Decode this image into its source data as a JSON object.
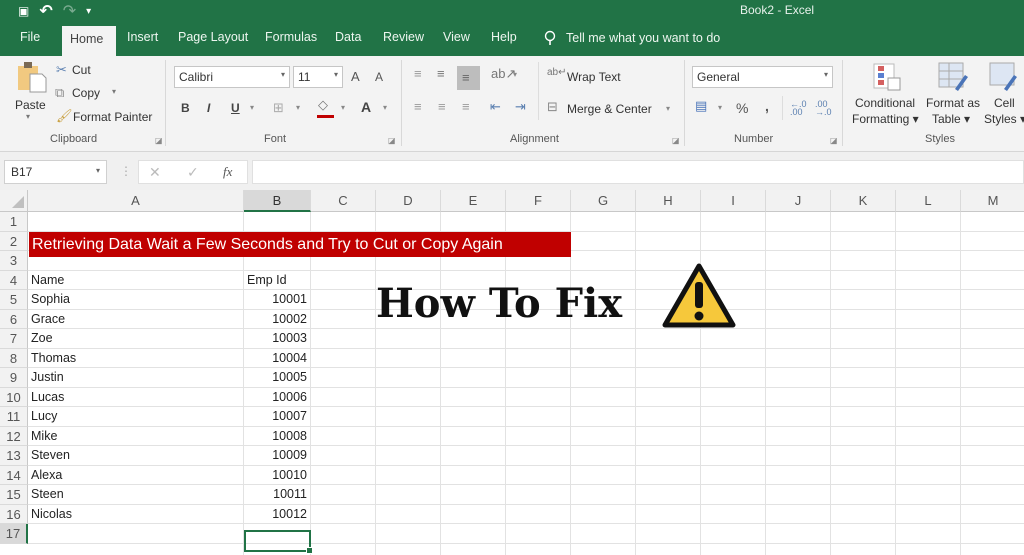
{
  "window": {
    "title": "Book2  -  Excel"
  },
  "qat": {
    "save_icon": "💾",
    "undo_icon": "↶",
    "redo_icon": "↷",
    "customize_icon": "▾"
  },
  "tabs": [
    {
      "label": "File"
    },
    {
      "label": "Home"
    },
    {
      "label": "Insert"
    },
    {
      "label": "Page Layout"
    },
    {
      "label": "Formulas"
    },
    {
      "label": "Data"
    },
    {
      "label": "Review"
    },
    {
      "label": "View"
    },
    {
      "label": "Help"
    }
  ],
  "tell_me": {
    "placeholder": "Tell me what you want to do",
    "icon": "💡"
  },
  "ribbon": {
    "clipboard": {
      "label": "Clipboard",
      "paste": "Paste",
      "cut": "Cut",
      "copy": "Copy",
      "format_painter": "Format Painter"
    },
    "font": {
      "label": "Font",
      "font_name": "Calibri",
      "font_size": "11",
      "bold": "B",
      "italic": "I",
      "underline": "U",
      "increase": "A",
      "decrease": "A",
      "font_color": "A",
      "fill_color_hex": "#c00000"
    },
    "alignment": {
      "label": "Alignment",
      "wrap_text": "Wrap Text",
      "merge_center": "Merge & Center"
    },
    "number": {
      "label": "Number",
      "format": "General",
      "percent": "%",
      "comma": ",",
      "inc_decimal": "←.0 .00",
      "dec_decimal": ".00 →.0"
    },
    "styles": {
      "label": "Styles",
      "conditional_1": "Conditional",
      "conditional_2": "Formatting ▾",
      "format_table_1": "Format as",
      "format_table_2": "Table ▾",
      "cell_styles_1": "Cell",
      "cell_styles_2": "Styles ▾"
    }
  },
  "formula_bar": {
    "name_box": "B17",
    "cancel": "✕",
    "enter": "✓",
    "fx": "fx",
    "formula": ""
  },
  "sheet": {
    "columns": [
      "A",
      "B",
      "C",
      "D",
      "E",
      "F",
      "G",
      "H",
      "I",
      "J",
      "K",
      "L",
      "M"
    ],
    "rows": [
      "1",
      "2",
      "3",
      "4",
      "5",
      "6",
      "7",
      "8",
      "9",
      "10",
      "11",
      "12",
      "13",
      "14",
      "15",
      "16",
      "17"
    ],
    "banner": "Retrieving Data Wait a Few Seconds and Try to Cut or Copy Again",
    "headers": {
      "name": "Name",
      "emp_id": "Emp Id"
    },
    "records": [
      {
        "name": "Sophia",
        "id": "10001"
      },
      {
        "name": "Grace",
        "id": "10002"
      },
      {
        "name": "Zoe",
        "id": "10003"
      },
      {
        "name": "Thomas",
        "id": "10004"
      },
      {
        "name": "Justin",
        "id": "10005"
      },
      {
        "name": "Lucas",
        "id": "10006"
      },
      {
        "name": "Lucy",
        "id": "10007"
      },
      {
        "name": "Mike",
        "id": "10008"
      },
      {
        "name": "Steven",
        "id": "10009"
      },
      {
        "name": "Alexa",
        "id": "10010"
      },
      {
        "name": "Steen",
        "id": "10011"
      },
      {
        "name": "Nicolas",
        "id": "10012"
      }
    ],
    "selected_cell": "B17",
    "overlay_text": "How To Fix",
    "accent": "#217346",
    "banner_color": "#c00000"
  }
}
